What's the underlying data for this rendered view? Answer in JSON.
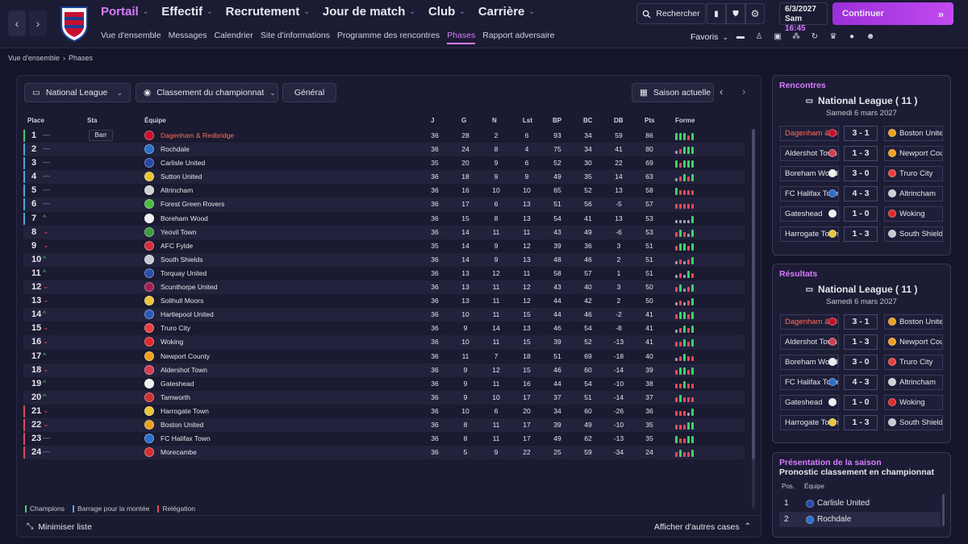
{
  "nav": {
    "main_menu": [
      "Portail",
      "Effectif",
      "Recrutement",
      "Jour de match",
      "Club",
      "Carrière"
    ],
    "sub_menu": [
      "Vue d'ensemble",
      "Messages",
      "Calendrier",
      "Site d'informations",
      "Programme des rencontres",
      "Phases",
      "Rapport adversaire"
    ],
    "search_label": "Rechercher",
    "date": "6/3/2027",
    "day": "Sam",
    "time": "16:45",
    "continue_label": "Continuer",
    "favoris_label": "Favoris"
  },
  "breadcrumb": [
    "Vue d'ensemble",
    "Phases"
  ],
  "filters": {
    "competition": "National League",
    "view": "Classement du championnat",
    "scope": "Général",
    "season": "Saison actuelle"
  },
  "table": {
    "headers": [
      "Place",
      "Sta",
      "Équipe",
      "J",
      "G",
      "N",
      "Lst",
      "BP",
      "BC",
      "DB",
      "Pts",
      "Forme"
    ],
    "badge_label": "Barr",
    "rows": [
      {
        "pos": "1",
        "trend": "same",
        "team": "Dagenham & Redbridge",
        "j": "36",
        "g": "28",
        "n": "2",
        "l": "6",
        "bp": "93",
        "bc": "34",
        "db": "59",
        "pts": "86",
        "zone": "champion",
        "mine": true,
        "logo": "#c8102e",
        "form": "WWWLW"
      },
      {
        "pos": "2",
        "trend": "same",
        "team": "Rochdale",
        "j": "36",
        "g": "24",
        "n": "8",
        "l": "4",
        "bp": "75",
        "bc": "34",
        "db": "41",
        "pts": "80",
        "zone": "playoff",
        "logo": "#2a6fc9",
        "form": "DLWWW"
      },
      {
        "pos": "3",
        "trend": "same",
        "team": "Carlisle United",
        "j": "35",
        "g": "20",
        "n": "9",
        "l": "6",
        "bp": "52",
        "bc": "30",
        "db": "22",
        "pts": "69",
        "zone": "playoff",
        "logo": "#2848a8",
        "form": "WLWWW"
      },
      {
        "pos": "4",
        "trend": "same",
        "team": "Sutton United",
        "j": "36",
        "g": "18",
        "n": "9",
        "l": "9",
        "bp": "49",
        "bc": "35",
        "db": "14",
        "pts": "63",
        "zone": "playoff",
        "logo": "#e8c53a",
        "form": "DLWLW"
      },
      {
        "pos": "5",
        "trend": "same",
        "team": "Altrincham",
        "j": "36",
        "g": "16",
        "n": "10",
        "l": "10",
        "bp": "65",
        "bc": "52",
        "db": "13",
        "pts": "58",
        "zone": "playoff",
        "logo": "#d0d0d8",
        "form": "WLLLL"
      },
      {
        "pos": "6",
        "trend": "same",
        "team": "Forest Green Rovers",
        "j": "36",
        "g": "17",
        "n": "6",
        "l": "13",
        "bp": "51",
        "bc": "56",
        "db": "-5",
        "pts": "57",
        "zone": "playoff",
        "logo": "#4dbb45",
        "form": "LLLLL"
      },
      {
        "pos": "7",
        "trend": "up",
        "team": "Boreham Wood",
        "j": "36",
        "g": "15",
        "n": "8",
        "l": "13",
        "bp": "54",
        "bc": "41",
        "db": "13",
        "pts": "53",
        "zone": "playoff",
        "logo": "#f0f0f0",
        "form": "DDDDW"
      },
      {
        "pos": "8",
        "trend": "down",
        "team": "Yeovil Town",
        "j": "36",
        "g": "14",
        "n": "11",
        "l": "11",
        "bp": "43",
        "bc": "49",
        "db": "-6",
        "pts": "53",
        "zone": "",
        "logo": "#3f9a3f",
        "form": "LWLDW"
      },
      {
        "pos": "9",
        "trend": "down",
        "team": "AFC Fylde",
        "j": "35",
        "g": "14",
        "n": "9",
        "l": "12",
        "bp": "39",
        "bc": "36",
        "db": "3",
        "pts": "51",
        "zone": "",
        "logo": "#d03040",
        "form": "LWWLW"
      },
      {
        "pos": "10",
        "trend": "up",
        "team": "South Shields",
        "j": "36",
        "g": "14",
        "n": "9",
        "l": "13",
        "bp": "48",
        "bc": "46",
        "db": "2",
        "pts": "51",
        "zone": "",
        "logo": "#c8c8d0",
        "form": "DLDLW"
      },
      {
        "pos": "11",
        "trend": "up",
        "team": "Torquay United",
        "j": "36",
        "g": "13",
        "n": "12",
        "l": "11",
        "bp": "58",
        "bc": "57",
        "db": "1",
        "pts": "51",
        "zone": "",
        "logo": "#2a4fa8",
        "form": "DLDWL"
      },
      {
        "pos": "12",
        "trend": "down",
        "team": "Scunthorpe United",
        "j": "36",
        "g": "13",
        "n": "11",
        "l": "12",
        "bp": "43",
        "bc": "40",
        "db": "3",
        "pts": "50",
        "zone": "",
        "logo": "#a02050",
        "form": "LWDLW"
      },
      {
        "pos": "13",
        "trend": "down",
        "team": "Solihull Moors",
        "j": "36",
        "g": "13",
        "n": "11",
        "l": "12",
        "bp": "44",
        "bc": "42",
        "db": "2",
        "pts": "50",
        "zone": "",
        "logo": "#e8c53a",
        "form": "DLDLW"
      },
      {
        "pos": "14",
        "trend": "up",
        "team": "Hartlepool United",
        "j": "36",
        "g": "10",
        "n": "11",
        "l": "15",
        "bp": "44",
        "bc": "46",
        "db": "-2",
        "pts": "41",
        "zone": "",
        "logo": "#2a5ab8",
        "form": "LWWLW"
      },
      {
        "pos": "15",
        "trend": "down",
        "team": "Truro City",
        "j": "36",
        "g": "9",
        "n": "14",
        "l": "13",
        "bp": "46",
        "bc": "54",
        "db": "-8",
        "pts": "41",
        "zone": "",
        "logo": "#e84040",
        "form": "DLWLW"
      },
      {
        "pos": "16",
        "trend": "down",
        "team": "Woking",
        "j": "36",
        "g": "10",
        "n": "11",
        "l": "15",
        "bp": "39",
        "bc": "52",
        "db": "-13",
        "pts": "41",
        "zone": "",
        "logo": "#e02a2a",
        "form": "LLWLW"
      },
      {
        "pos": "17",
        "trend": "up",
        "team": "Newport County",
        "j": "36",
        "g": "11",
        "n": "7",
        "l": "18",
        "bp": "51",
        "bc": "69",
        "db": "-18",
        "pts": "40",
        "zone": "",
        "logo": "#f0a020",
        "form": "DLWLL"
      },
      {
        "pos": "18",
        "trend": "down",
        "team": "Aldershot Town",
        "j": "36",
        "g": "9",
        "n": "12",
        "l": "15",
        "bp": "46",
        "bc": "60",
        "db": "-14",
        "pts": "39",
        "zone": "",
        "logo": "#d04050",
        "form": "LWWLW"
      },
      {
        "pos": "19",
        "trend": "up",
        "team": "Gateshead",
        "j": "36",
        "g": "9",
        "n": "11",
        "l": "16",
        "bp": "44",
        "bc": "54",
        "db": "-10",
        "pts": "38",
        "zone": "",
        "logo": "#f0f0f0",
        "form": "LLWLL"
      },
      {
        "pos": "20",
        "trend": "up",
        "team": "Tamworth",
        "j": "36",
        "g": "9",
        "n": "10",
        "l": "17",
        "bp": "37",
        "bc": "51",
        "db": "-14",
        "pts": "37",
        "zone": "",
        "logo": "#d03030",
        "form": "LWLLL"
      },
      {
        "pos": "21",
        "trend": "down",
        "team": "Harrogate Town",
        "j": "36",
        "g": "10",
        "n": "6",
        "l": "20",
        "bp": "34",
        "bc": "60",
        "db": "-26",
        "pts": "36",
        "zone": "relegation",
        "logo": "#e8c53a",
        "form": "LLLDW"
      },
      {
        "pos": "22",
        "trend": "down",
        "team": "Boston United",
        "j": "36",
        "g": "8",
        "n": "11",
        "l": "17",
        "bp": "39",
        "bc": "49",
        "db": "-10",
        "pts": "35",
        "zone": "relegation",
        "logo": "#e8a020",
        "form": "LLLWW"
      },
      {
        "pos": "23",
        "trend": "same",
        "team": "FC Halifax Town",
        "j": "36",
        "g": "8",
        "n": "11",
        "l": "17",
        "bp": "49",
        "bc": "62",
        "db": "-13",
        "pts": "35",
        "zone": "relegation",
        "logo": "#2a6fc9",
        "form": "WLLWW"
      },
      {
        "pos": "24",
        "trend": "same",
        "team": "Morecambe",
        "j": "36",
        "g": "5",
        "n": "9",
        "l": "22",
        "bp": "25",
        "bc": "59",
        "db": "-34",
        "pts": "24",
        "zone": "relegation",
        "logo": "#d03030",
        "form": "LWLLW"
      }
    ]
  },
  "legend": {
    "champions": "Champions",
    "playoff": "Barrage pour la montée",
    "relegation": "Relégation"
  },
  "bottom": {
    "minimize": "Minimiser liste",
    "more": "Afficher d'autres cases"
  },
  "fixtures": {
    "title": "Rencontres",
    "league": "National League  ( 11 )",
    "date": "Samedi 6 mars 2027",
    "matches": [
      {
        "home": "Dagenham & Redbridge",
        "score": "3 - 1",
        "away": "Boston United",
        "mine": true,
        "hlogo": "#c8102e",
        "alogo": "#e8a020"
      },
      {
        "home": "Aldershot Town",
        "score": "1 - 3",
        "away": "Newport County",
        "hlogo": "#d04050",
        "alogo": "#f0a020"
      },
      {
        "home": "Boreham Wood",
        "score": "3 - 0",
        "away": "Truro City",
        "hlogo": "#f0f0f0",
        "alogo": "#e84040"
      },
      {
        "home": "FC Halifax Town",
        "score": "4 - 3",
        "away": "Altrincham",
        "hlogo": "#2a6fc9",
        "alogo": "#d0d0d8"
      },
      {
        "home": "Gateshead",
        "score": "1 - 0",
        "away": "Woking",
        "hlogo": "#f0f0f0",
        "alogo": "#e02a2a"
      },
      {
        "home": "Harrogate Town",
        "score": "1 - 3",
        "away": "South Shields",
        "hlogo": "#e8c53a",
        "alogo": "#c8c8d0"
      }
    ]
  },
  "results": {
    "title": "Résultats",
    "league": "National League  ( 11 )",
    "date": "Samedi 6 mars 2027",
    "matches": [
      {
        "home": "Dagenham & Redbridge",
        "score": "3 - 1",
        "away": "Boston United",
        "mine": true,
        "hlogo": "#c8102e",
        "alogo": "#e8a020"
      },
      {
        "home": "Aldershot Town",
        "score": "1 - 3",
        "away": "Newport County",
        "hlogo": "#d04050",
        "alogo": "#f0a020"
      },
      {
        "home": "Boreham Wood",
        "score": "3 - 0",
        "away": "Truro City",
        "hlogo": "#f0f0f0",
        "alogo": "#e84040"
      },
      {
        "home": "FC Halifax Town",
        "score": "4 - 3",
        "away": "Altrincham",
        "hlogo": "#2a6fc9",
        "alogo": "#d0d0d8"
      },
      {
        "home": "Gateshead",
        "score": "1 - 0",
        "away": "Woking",
        "hlogo": "#f0f0f0",
        "alogo": "#e02a2a"
      },
      {
        "home": "Harrogate Town",
        "score": "1 - 3",
        "away": "South Shields",
        "hlogo": "#e8c53a",
        "alogo": "#c8c8d0"
      }
    ]
  },
  "season_preview": {
    "title": "Présentation de la saison",
    "subtitle": "Pronostic classement en championnat",
    "headers": [
      "Pos.",
      "Équipe"
    ],
    "rows": [
      {
        "pos": "1",
        "team": "Carlisle United",
        "logo": "#2848a8"
      },
      {
        "pos": "2",
        "team": "Rochdale",
        "logo": "#2a6fc9"
      }
    ]
  },
  "colors": {
    "accent": "#d77cff",
    "mine": "#ff7059",
    "champion": "#3fd16b",
    "playoff": "#4aa8d8",
    "relegation": "#e04a5a",
    "trend_up": "#3fd16b",
    "trend_down": "#e04a5a"
  }
}
